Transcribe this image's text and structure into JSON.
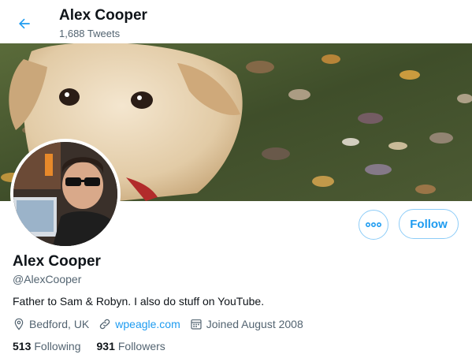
{
  "header": {
    "back_icon": "arrow-left-icon",
    "title": "Alex Cooper",
    "tweet_count": "1,688 Tweets"
  },
  "profile": {
    "name": "Alex Cooper",
    "handle": "@AlexCooper",
    "bio": "Father to Sam & Robyn. I also do stuff on YouTube.",
    "location": "Bedford, UK",
    "website": "wpeagle.com",
    "joined": "Joined August 2008",
    "following_count": "513",
    "following_label": "Following",
    "followers_count": "931",
    "followers_label": "Followers"
  },
  "actions": {
    "more_icon": "more-horizontal-icon",
    "follow_label": "Follow"
  },
  "colors": {
    "accent": "#1d9bf0",
    "text": "#0f1419",
    "secondary": "#536471"
  }
}
